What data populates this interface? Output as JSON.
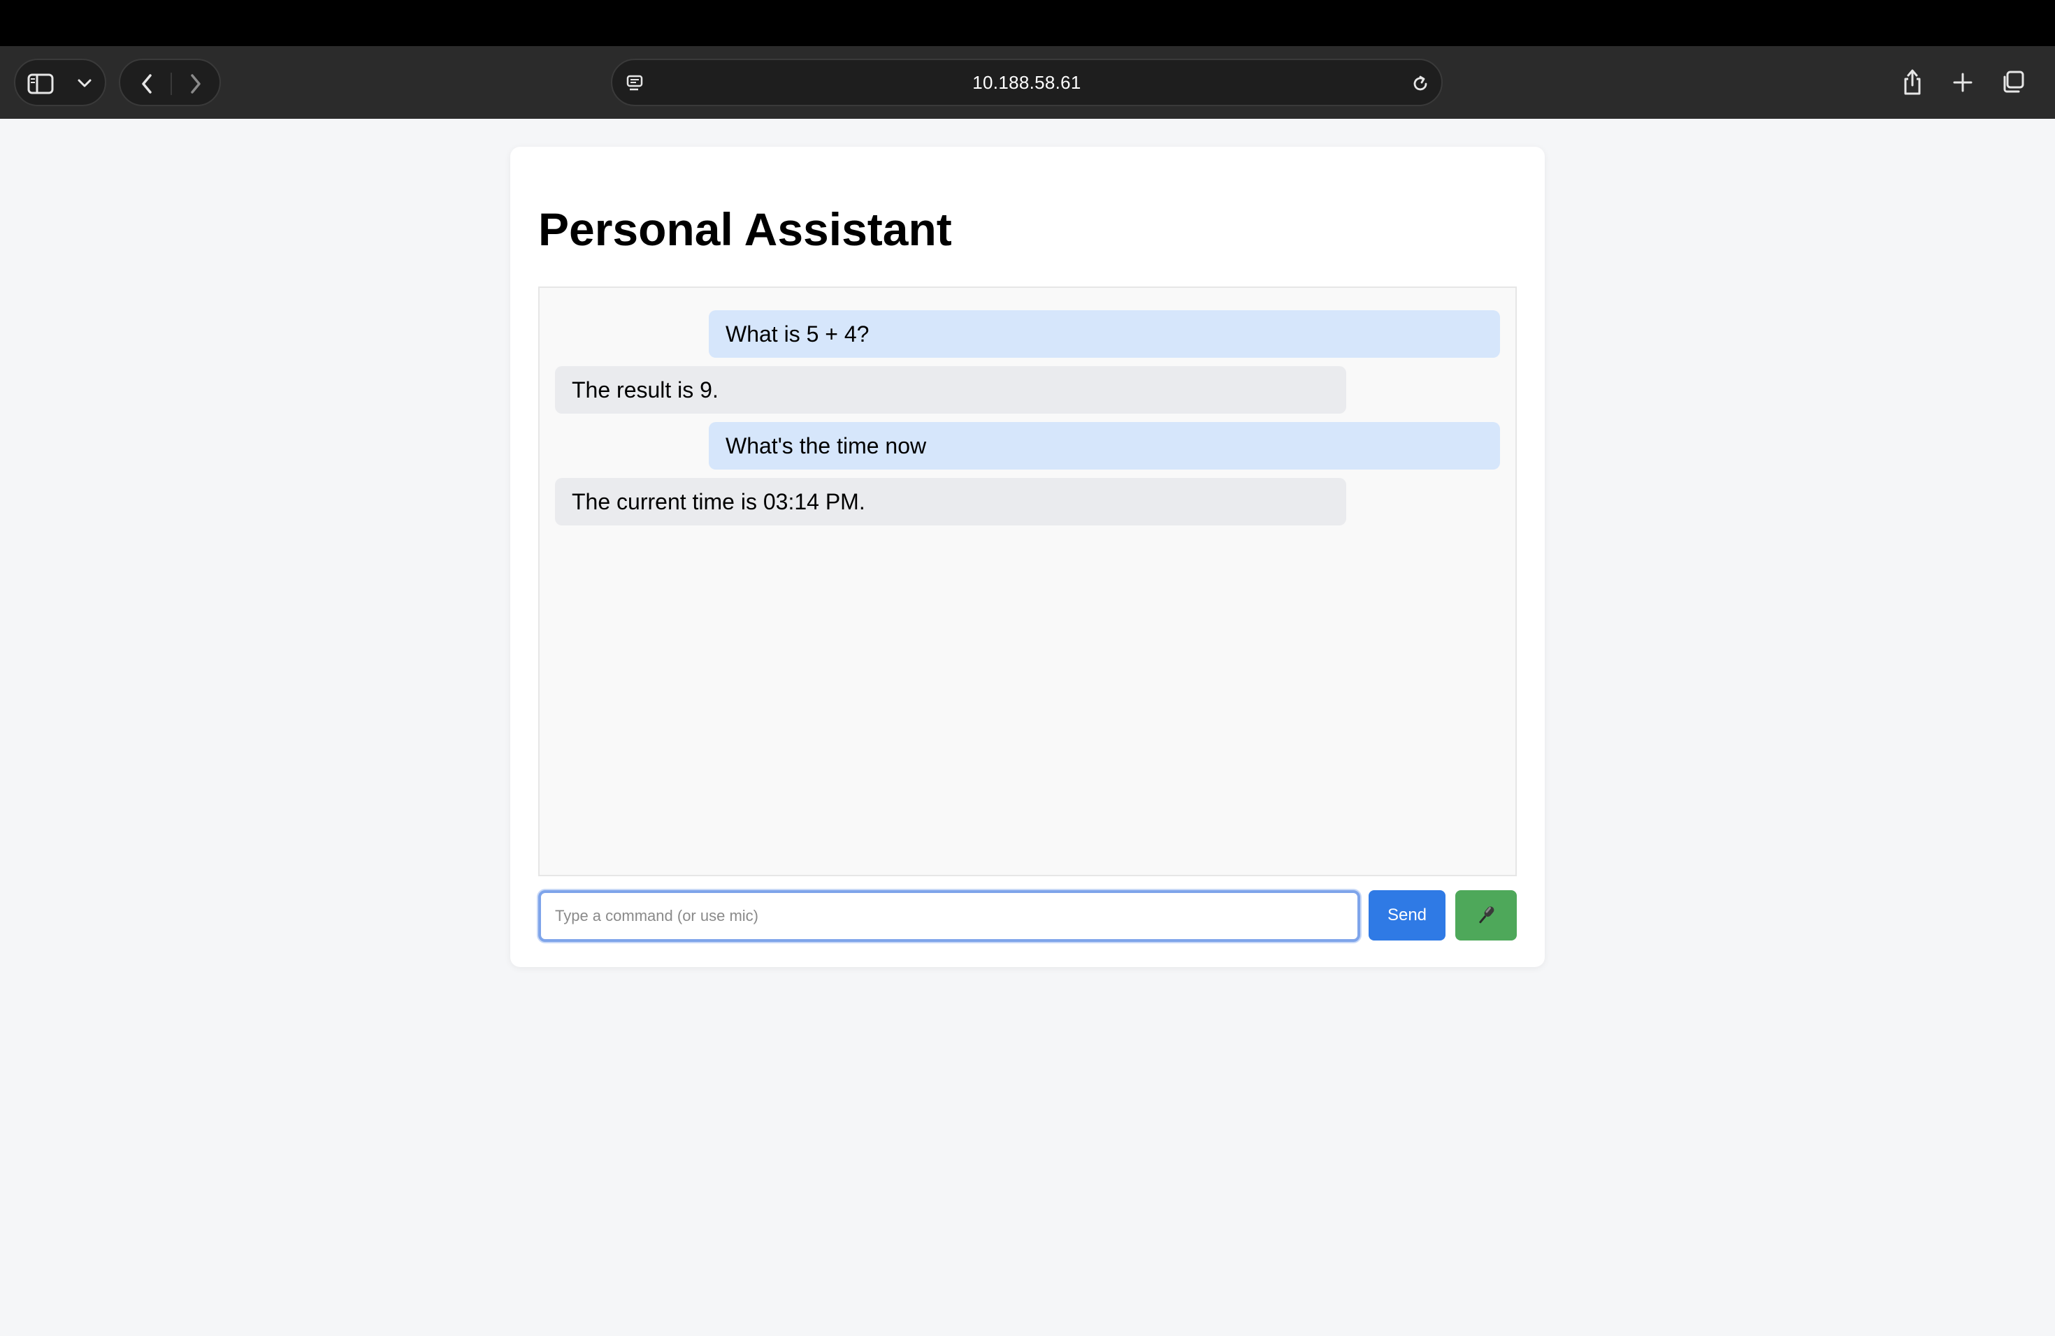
{
  "browser": {
    "url": "10.188.58.61",
    "icons": [
      "sidebar-icon",
      "chevron-down-icon",
      "back-icon",
      "forward-icon",
      "site-settings-icon",
      "reload-icon",
      "share-icon",
      "new-tab-icon",
      "tabs-overview-icon"
    ]
  },
  "app": {
    "title": "Personal Assistant",
    "messages": [
      {
        "role": "user",
        "text": "What is 5 + 4?"
      },
      {
        "role": "assistant",
        "text": "The result is 9."
      },
      {
        "role": "user",
        "text": "What's the time now"
      },
      {
        "role": "assistant",
        "text": "The current time is 03:14 PM."
      }
    ],
    "input": {
      "placeholder": "Type a command (or use mic)",
      "value": ""
    },
    "send_label": "Send",
    "mic_icon": "microphone-icon"
  },
  "colors": {
    "user_bubble": "#d6e6fb",
    "assistant_bubble": "#eaebee",
    "send_button": "#2f7ae5",
    "mic_button": "#4ea85a"
  }
}
